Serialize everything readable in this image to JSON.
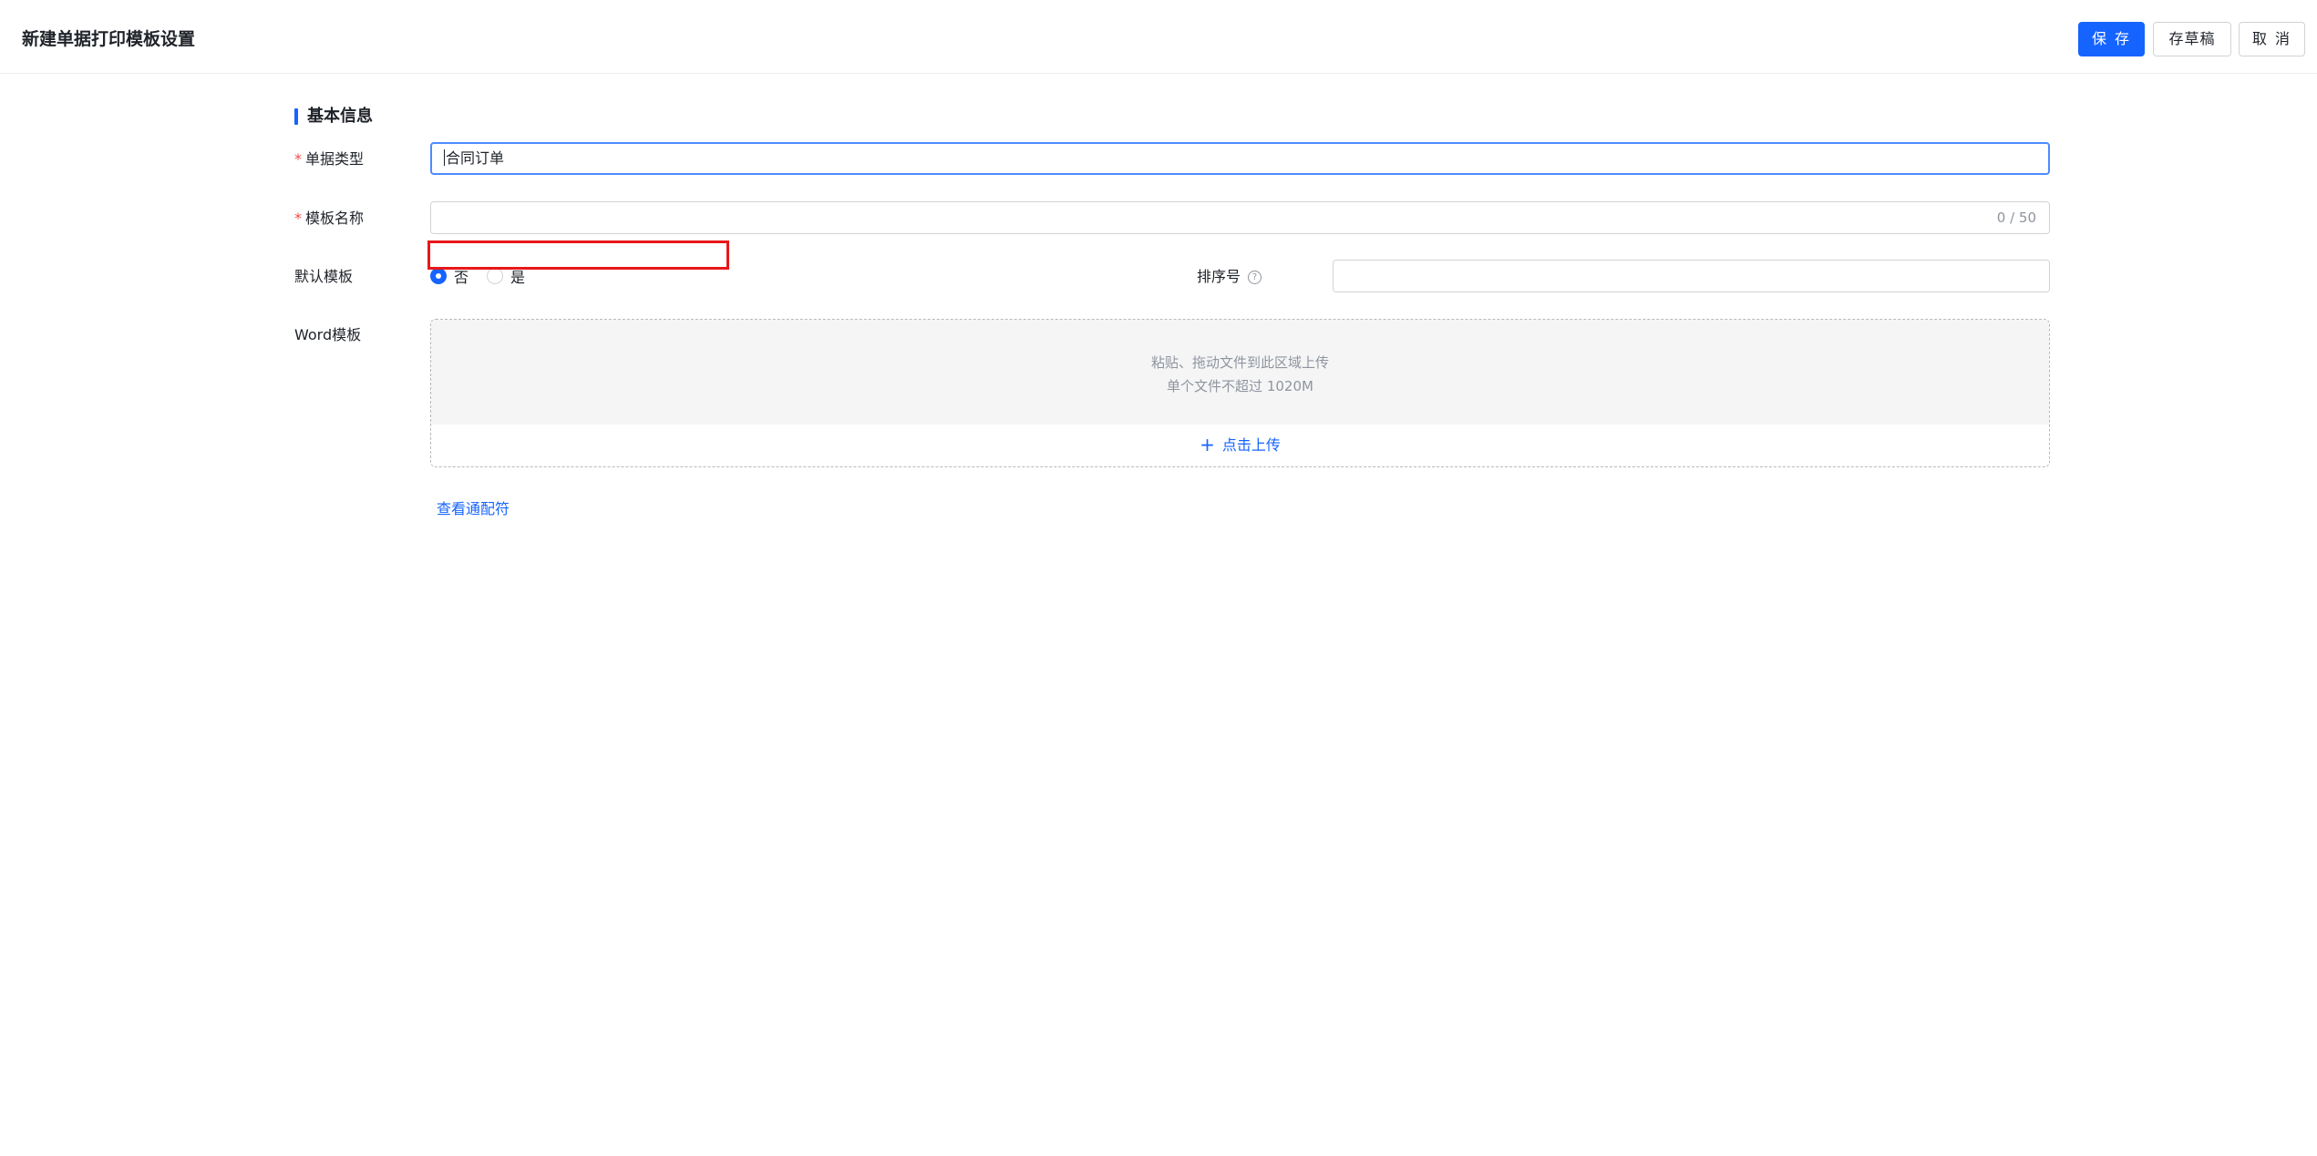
{
  "header": {
    "title": "新建单据打印模板设置",
    "save_label": "保 存",
    "draft_label": "存草稿",
    "cancel_label": "取 消"
  },
  "section": {
    "title": "基本信息"
  },
  "form": {
    "required_mark": "*",
    "doc_type": {
      "label": "单据类型",
      "value": "合同订单"
    },
    "template_name": {
      "label": "模板名称",
      "value": "",
      "counter": "0 / 50"
    },
    "default_template": {
      "label": "默认模板",
      "options": [
        "否",
        "是"
      ],
      "selected": "否"
    },
    "sort_number": {
      "label": "排序号",
      "value": ""
    },
    "word_template": {
      "label": "Word模板",
      "hint_line1": "粘贴、拖动文件到此区域上传",
      "hint_line2": "单个文件不超过 1020M",
      "upload_label": "点击上传"
    },
    "wildcard_link": "查看通配符"
  },
  "icons": {
    "help": "question-circle-icon",
    "plus": "plus-icon"
  },
  "colors": {
    "primary": "#1664ff",
    "required": "#f54a45",
    "highlight": "#e8171a"
  }
}
